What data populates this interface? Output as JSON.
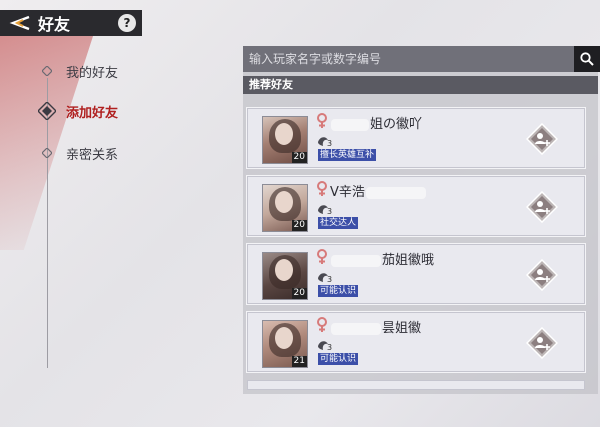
{
  "header": {
    "title": "好友",
    "help": "?"
  },
  "nav": [
    {
      "label": "我的好友",
      "active": false
    },
    {
      "label": "添加好友",
      "active": true
    },
    {
      "label": "亲密关系",
      "active": false
    }
  ],
  "search": {
    "placeholder": "输入玩家名字或数字编号",
    "icon": "search-icon"
  },
  "section_title": "推荐好友",
  "friends": [
    {
      "name_suffix": "姐の徽吖",
      "level": "20",
      "rank": "3",
      "tag": "擅长英雄互补"
    },
    {
      "name_prefix": "V辛浩",
      "level": "20",
      "rank": "3",
      "tag": "社交达人"
    },
    {
      "name_suffix": "茄姐徽哦",
      "level": "20",
      "rank": "3",
      "tag": "可能认识"
    },
    {
      "name_suffix": "昙姐徽",
      "level": "21",
      "rank": "3",
      "tag": "可能认识"
    }
  ],
  "colors": {
    "header_bg": "#2a2a2e",
    "active_nav": "#b02020",
    "tag_bg": "#3c4fa8",
    "gender_female": "#d77a7a"
  }
}
